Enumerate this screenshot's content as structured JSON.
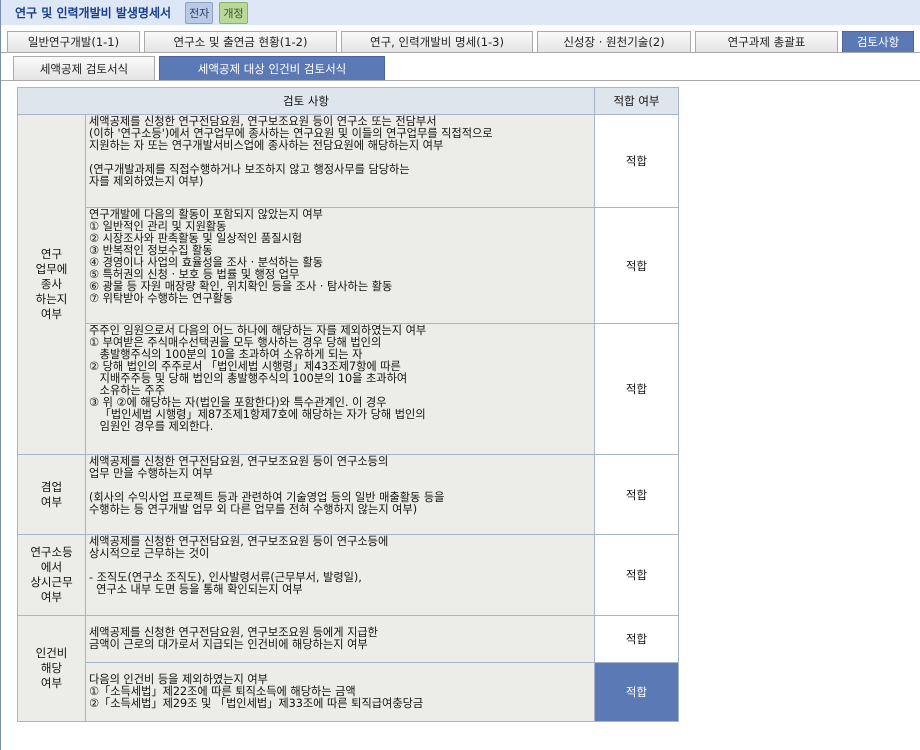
{
  "header": {
    "title": "연구 및 인력개발비 발생명세서",
    "badge1": "전자",
    "badge2": "개정"
  },
  "tabs": [
    "일반연구개발(1-1)",
    "연구소 및 출연금 현황(1-2)",
    "연구, 인력개발비 명세(1-3)",
    "신성장 · 원천기술(2)",
    "연구과제 총괄표",
    "검토사항"
  ],
  "subtabs": [
    "세액공제 검토서식",
    "세액공제 대상 인건비 검토서식"
  ],
  "table": {
    "headers": [
      "검토 사항",
      "적합 여부"
    ],
    "categories": [
      "연구\n업무에\n종사\n하는지\n여부",
      "겸업\n여부",
      "연구소등\n에서\n상시근무\n여부",
      "인건비\n해당\n여부"
    ],
    "rows": [
      {
        "text": "세액공제를 신청한 연구전담요원, 연구보조요원 등이 연구소 또는 전담부서\n(이하 '연구소등')에서 연구업무에 종사하는 연구요원 및 이들의 연구업무를 직접적으로\n지원하는 자 또는 연구개발서비스업에 종사하는 전담요원에 해당하는지 여부\n\n(연구개발과제를 직접수행하거나 보조하지 않고 행정사무를 담당하는\n자를 제외하였는지 여부)",
        "result": "적합"
      },
      {
        "text": "연구개발에 다음의 활동이 포함되지 않았는지 여부\n① 일반적인 관리 및 지원활동\n② 시장조사와 판촉활동 및 일상적인 품질시험\n③ 반복적인 정보수집 활동\n④ 경영이나 사업의 효율성을 조사 · 분석하는 활동\n⑤ 특허권의 신청 · 보호 등 법률 및 행정 업무\n⑥ 광물 등 자원 매장량 확인, 위치확인 등을 조사 · 탐사하는 활동\n⑦ 위탁받아 수행하는 연구활동",
        "result": "적합"
      },
      {
        "text": "주주인 임원으로서 다음의 어느 하나에 해당하는 자를 제외하였는지 여부\n① 부여받은 주식매수선택권을 모두 행사하는 경우 당해 법인의\n   총발행주식의 100분의 10을 초과하여 소유하게 되는 자\n② 당해 법인의 주주로서 「법인세법 시행령」제43조제7항에 따른\n   지배주주등 및 당해 법인의 총발행주식의 100분의 10을 초과하여\n   소유하는 주주\n③ 위 ②에 해당하는 자(법인을 포함한다)와 특수관계인. 이 경우\n   「법인세법 시행령」제87조제1항제7호에 해당하는 자가 당해 법인의\n   임원인 경우를 제외한다.",
        "result": "적합"
      },
      {
        "text": "세액공제를 신청한 연구전담요원, 연구보조요원 등이 연구소등의\n업무 만을 수행하는지 여부\n\n(회사의 수익사업 프로젝트 등과 관련하여 기술영업 등의 일반 매출활동 등을\n수행하는 등 연구개발 업무 외 다른 업무를 전혀 수행하지 않는지 여부)",
        "result": "적합"
      },
      {
        "text": "세액공제를 신청한 연구전담요원, 연구보조요원 등이 연구소등에\n상시적으로 근무하는 것이\n\n- 조직도(연구소 조직도), 인사발령서류(근무부서, 발령일),\n  연구소 내부 도면 등을 통해 확인되는지 여부",
        "result": "적합"
      },
      {
        "text": "세액공제를 신청한 연구전담요원, 연구보조요원 등에게 지급한\n금액이 근로의 대가로서 지급되는 인건비에 해당하는지 여부",
        "result": "적합"
      },
      {
        "text": "다음의 인건비 등을 제외하였는지 여부\n①「소득세법」제22조에 따른 퇴직소득에 해당하는 금액\n②「소득세법」제29조 및 「법인세법」제33조에 따른 퇴직급여충당금",
        "result": "적합"
      }
    ]
  }
}
